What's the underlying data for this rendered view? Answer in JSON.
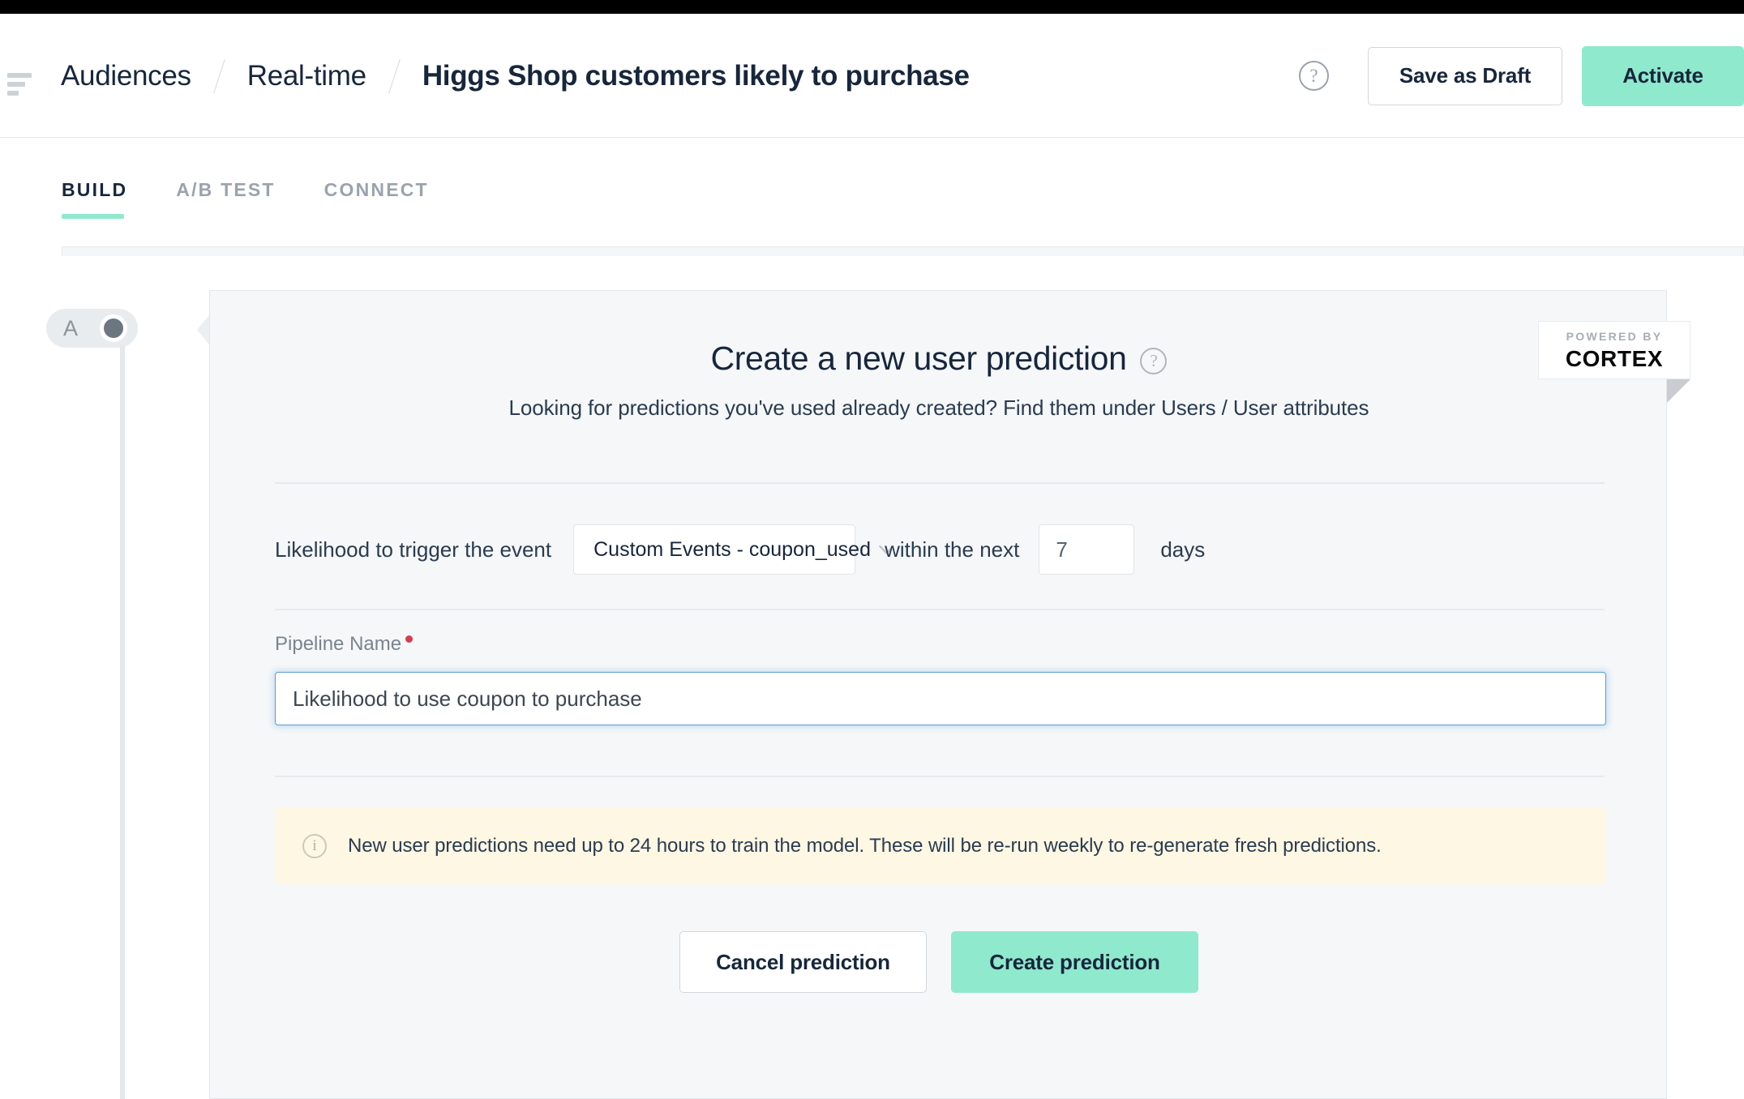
{
  "header": {
    "menu_icon": "hamburger-menu-icon",
    "breadcrumb": {
      "item1": "Audiences",
      "item2": "Real-time",
      "current": "Higgs Shop customers likely to purchase"
    },
    "help_icon": "question-mark-icon",
    "save_draft_label": "Save as Draft",
    "activate_label": "Activate"
  },
  "tabs": [
    {
      "label": "BUILD",
      "active": true
    },
    {
      "label": "A/B TEST",
      "active": false
    },
    {
      "label": "CONNECT",
      "active": false
    }
  ],
  "flow": {
    "node_label": "A"
  },
  "card": {
    "title": "Create a new user prediction",
    "title_help_icon": "question-mark-icon",
    "subtitle": "Looking for predictions you've used already created? Find them under Users / User attributes",
    "ribbon": {
      "powered_by": "POWERED BY",
      "brand": "CORTEX"
    },
    "event_row": {
      "label": "Likelihood to trigger the event",
      "select_value": "Custom Events - coupon_used",
      "chevron_icon": "chevron-down-icon",
      "mid_label": "within the next",
      "days_value": "7",
      "days_placeholder": "7",
      "unit_label": "days"
    },
    "pipeline": {
      "label": "Pipeline Name",
      "required": true,
      "value": "Likelihood to use coupon to purchase",
      "placeholder": "Pipeline Name"
    },
    "banner": {
      "icon": "info-icon",
      "text": "New user predictions need up to 24 hours to train the model. These will be re-run weekly to re-generate fresh predictions."
    },
    "actions": {
      "cancel_label": "Cancel prediction",
      "create_label": "Create prediction"
    }
  },
  "colors": {
    "accent_mint": "#8fe9cd",
    "text_dark": "#17263c",
    "text_muted": "#9aa3ad",
    "banner_bg": "#fdf7e3",
    "required_dot": "#d93b4e",
    "focus_blue": "#5b9bd5"
  }
}
